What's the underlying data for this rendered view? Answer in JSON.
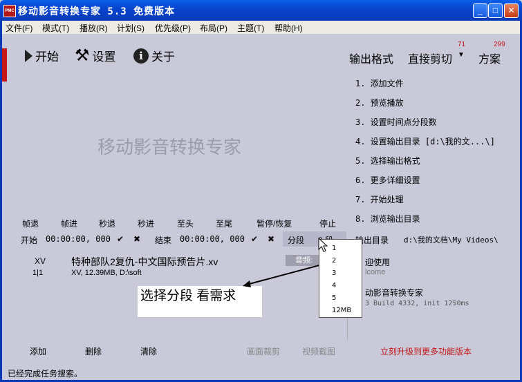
{
  "window": {
    "logo": "PMC",
    "title": "移动影音转换专家 5.3 免费版本",
    "controls": {
      "min": "_",
      "max": "□",
      "close": "✕"
    }
  },
  "menu": [
    "文件(F)",
    "模式(T)",
    "播放(R)",
    "计划(S)",
    "优先级(P)",
    "布局(P)",
    "主题(T)",
    "帮助(H)"
  ],
  "toolbar": {
    "start": "开始",
    "settings": "设置",
    "about": "关于",
    "output_format": "输出格式",
    "direct_cut": "直接剪切",
    "direct_cut_badge": "71",
    "scheme": "方案",
    "scheme_badge": "299"
  },
  "watermark": "移动影音转换专家",
  "steps": [
    "1. 添加文件",
    "2. 预览播放",
    "3. 设置时间点分段数",
    "4. 设置输出目录 [d:\\我的文...\\]",
    "5. 选择输出格式",
    "6. 更多详细设置",
    "7. 开始处理",
    "8. 浏览输出目录"
  ],
  "controls": [
    "帧退",
    "帧进",
    "秒退",
    "秒进",
    "至头",
    "至尾",
    "暂停/恢复",
    "停止"
  ],
  "timeline": {
    "start_label": "开始",
    "start_time": "00:00:00, 000",
    "end_label": "结束",
    "end_time": "00:00:00, 000",
    "segment_label": "分段",
    "segment_value": "2 段"
  },
  "output_dir": {
    "label": "输出目录",
    "value": "d:\\我的文档\\My Videos\\"
  },
  "file": {
    "format": "XV",
    "index": "1|1",
    "name": "特种部队2复仇-中文国际预告片.xv",
    "info": "XV, 12.39MB, D:\\soft",
    "audio": "音频:"
  },
  "welcome": {
    "line1": "迎使用",
    "line2": "lcome",
    "line3": "动影音转换专家",
    "line4": "3 Build 4332, init 1250ms"
  },
  "callout": "选择分段 看需求",
  "segment_options": [
    "1",
    "2",
    "3",
    "4",
    "5",
    "12MB"
  ],
  "bottom": {
    "add": "添加",
    "delete": "删除",
    "clear": "清除",
    "crop": "画面裁剪",
    "capture": "视频截图",
    "upgrade": "立刻升级到更多功能版本"
  },
  "status": "已经完成任务搜索。"
}
